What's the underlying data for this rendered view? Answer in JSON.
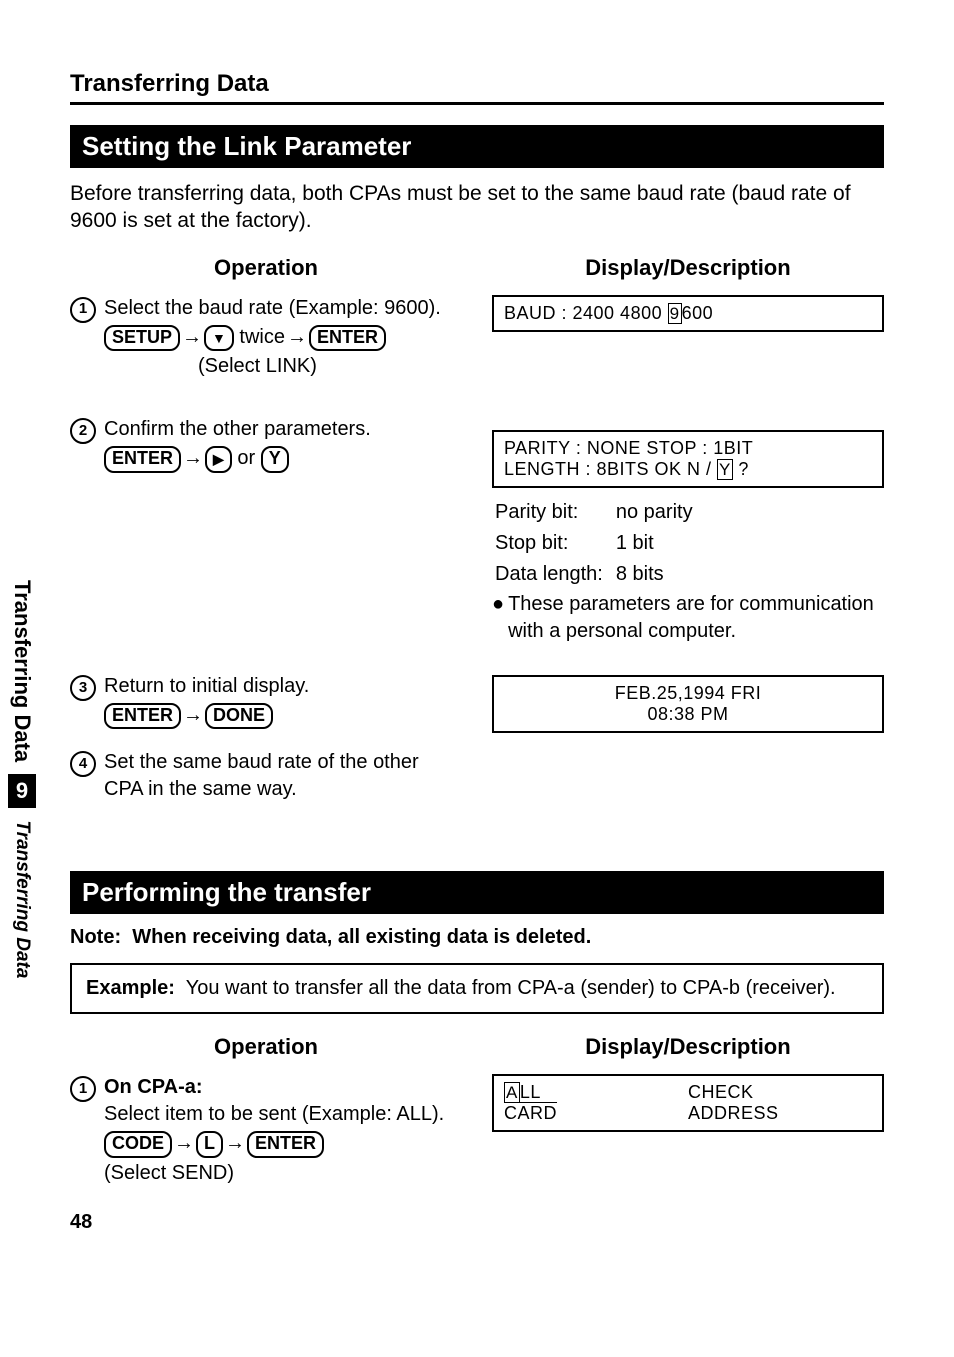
{
  "title": "Transferring Data",
  "sidebar": {
    "label_top": "Transferring Data",
    "chapter": "9",
    "label_bottom": "Transferring Data"
  },
  "section1": {
    "header": "Setting the Link Parameter",
    "intro": "Before transferring data, both CPAs must be set to the same baud rate (baud rate of 9600 is set at the factory).",
    "col_operation": "Operation",
    "col_display": "Display/Description",
    "steps": {
      "s1": {
        "text": "Select the baud rate (Example: 9600).",
        "k_setup": "SETUP",
        "k_twice": " twice",
        "k_enter": "ENTER",
        "sub": "(Select LINK)"
      },
      "s2": {
        "text": "Confirm the other parameters.",
        "k_enter": "ENTER",
        "k_or": " or ",
        "k_y": "Y"
      },
      "s3": {
        "text": "Return to initial display.",
        "k_enter": "ENTER",
        "k_done": "DONE"
      },
      "s4": {
        "text": "Set the same baud rate of the other CPA in the same way."
      }
    },
    "displays": {
      "d1": {
        "pre": "BAUD :   2400   4800  ",
        "cursor": "9",
        "post": "600"
      },
      "d2a": "PARITY : NONE   STOP : 1BIT",
      "d2b_pre": "LENGTH : 8BITS   OK  N / ",
      "d2b_cursor": "Y",
      "d2b_post": " ?",
      "d2_desc_parity_l": "Parity bit:",
      "d2_desc_parity_v": "no parity",
      "d2_desc_stop_l": "Stop bit:",
      "d2_desc_stop_v": "1 bit",
      "d2_desc_len_l": "Data length:",
      "d2_desc_len_v": "8 bits",
      "d2_note": "These parameters are for communication with a personal computer.",
      "d3a": "FEB.25,1994  FRI",
      "d3b": "08:38  PM"
    }
  },
  "section2": {
    "header": "Performing the transfer",
    "note_label": "Note:",
    "note_text": "When receiving data, all existing data is deleted.",
    "example_label": "Example:",
    "example_text": "You want to transfer all the data from CPA-a (sender) to CPA-b (receiver).",
    "col_operation": "Operation",
    "col_display": "Display/Description",
    "steps": {
      "s1": {
        "title": "On CPA-a:",
        "text": "Select item to be sent (Example: ALL).",
        "k_code": "CODE",
        "k_l": "L",
        "k_enter": "ENTER",
        "sub": "(Select SEND)"
      }
    },
    "displays": {
      "menu_all_cursor": "A",
      "menu_all_post": "LL",
      "menu_card": "CARD",
      "menu_check": "CHECK",
      "menu_address": "ADDRESS"
    }
  },
  "page_number": "48"
}
